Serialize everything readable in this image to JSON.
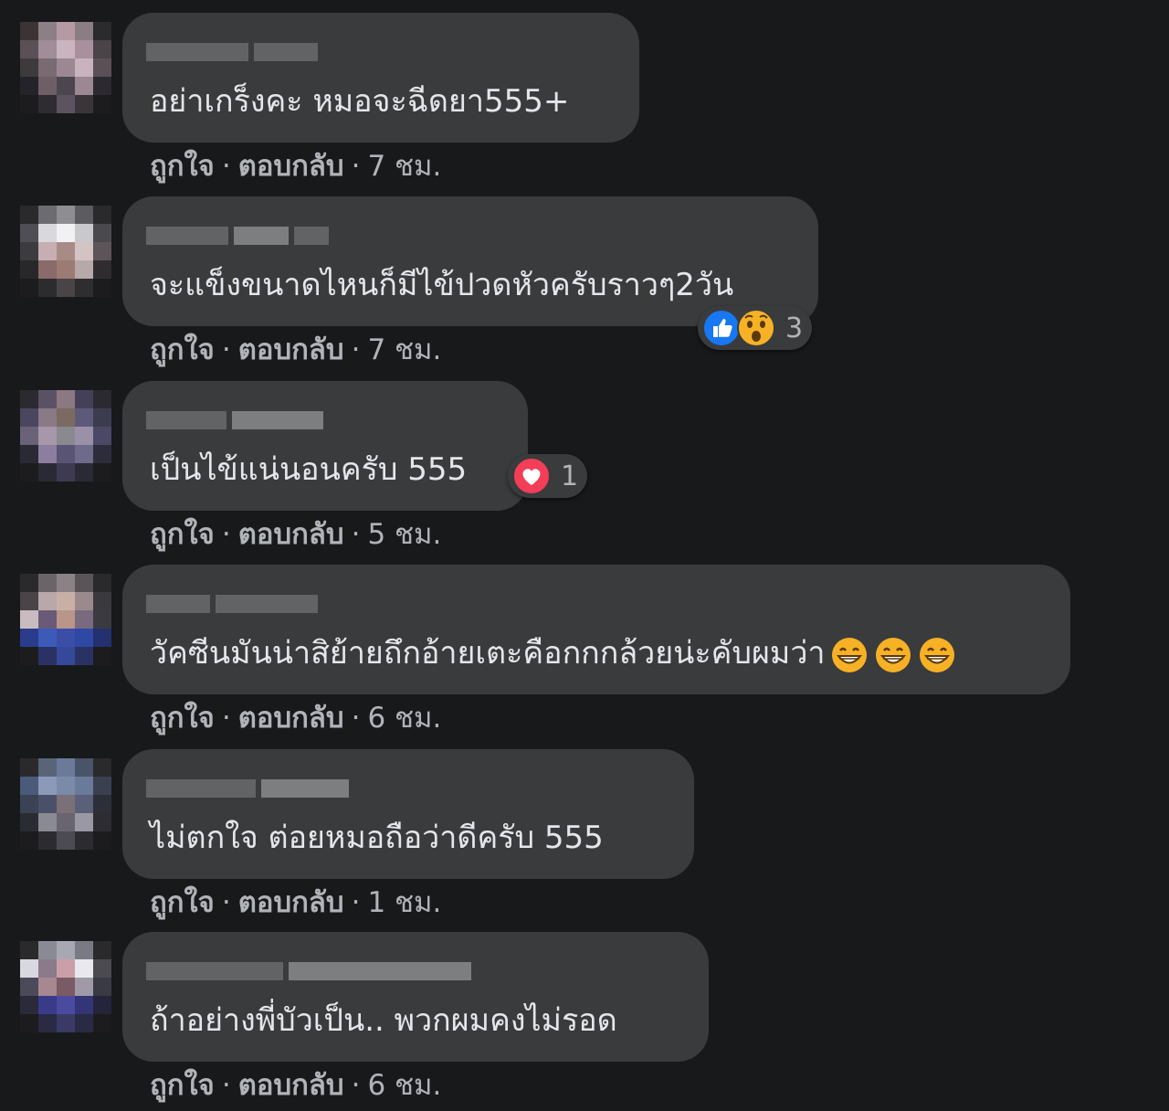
{
  "comments": [
    {
      "text": "อย่าเกร็งคะ หมอจะฉีดยา555+",
      "like_label": "ถูกใจ",
      "reply_label": "ตอบกลับ",
      "time": "7 ชม."
    },
    {
      "text": "จะแข็งขนาดไหนก็มีไข้ปวดหัวครับราวๆ2วัน",
      "like_label": "ถูกใจ",
      "reply_label": "ตอบกลับ",
      "time": "7 ชม.",
      "reactions": {
        "icons": [
          "like-icon",
          "wow-icon"
        ],
        "count": "3"
      }
    },
    {
      "text": "เป็นไข้แน่นอนครับ 555",
      "like_label": "ถูกใจ",
      "reply_label": "ตอบกลับ",
      "time": "5 ชม.",
      "reactions": {
        "icons": [
          "love-icon"
        ],
        "count": "1"
      }
    },
    {
      "text": "วัคซีนมันน่าสิย้ายถึกอ้ายเตะคือกกกล้วยน่ะคับผมว่า",
      "emoji": [
        "grinning-emoji",
        "grinning-emoji",
        "grinning-emoji"
      ],
      "like_label": "ถูกใจ",
      "reply_label": "ตอบกลับ",
      "time": "6 ชม."
    },
    {
      "text": "ไม่ตกใจ ต่อยหมอถือว่าดีครับ 555",
      "like_label": "ถูกใจ",
      "reply_label": "ตอบกลับ",
      "time": "1 ชม."
    },
    {
      "text": "ถ้าอย่างพี่บัวเป็น.. พวกผมคงไม่รอด",
      "like_label": "ถูกใจ",
      "reply_label": "ตอบกลับ",
      "time": "6 ชม."
    }
  ],
  "colors": {
    "background": "#18191a",
    "bubble": "#3a3b3c",
    "text": "#e4e6eb",
    "meta": "#b0b3b8",
    "like_blue": "#1877f2",
    "love_red": "#f33e58",
    "wow_yellow": "#f7b125"
  }
}
